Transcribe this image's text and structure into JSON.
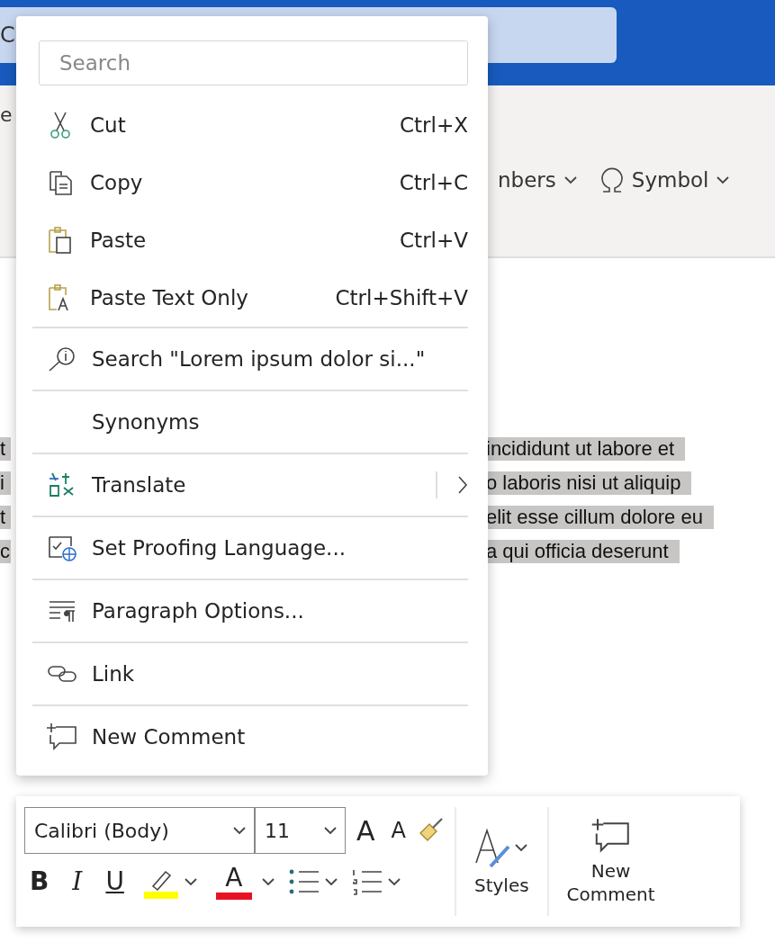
{
  "title_bar": {
    "search_fragment": "C"
  },
  "ribbon": {
    "tab_fragment": "e",
    "controls": [
      {
        "label": "nbers",
        "kind": "dropdown"
      },
      {
        "label": "Symbol",
        "kind": "symbol"
      }
    ]
  },
  "document": {
    "lines": [
      {
        "left": "t",
        "right": "incididunt ut labore et",
        "selected": true
      },
      {
        "left": "i",
        "right": "o laboris nisi ut aliquip",
        "selected": true
      },
      {
        "left": "t",
        "right": "elit esse cillum dolore eu",
        "selected": true
      },
      {
        "left": "c",
        "right": "a qui officia deserunt",
        "selected": true
      }
    ]
  },
  "context_menu": {
    "search": {
      "placeholder": "Search"
    },
    "sections": [
      [
        {
          "label": "Cut",
          "shortcut": "Ctrl+X"
        },
        {
          "label": "Copy",
          "shortcut": "Ctrl+C"
        },
        {
          "label": "Paste",
          "shortcut": "Ctrl+V"
        },
        {
          "label": "Paste Text Only",
          "shortcut": "Ctrl+Shift+V"
        }
      ],
      [
        {
          "label": "Search \"Lorem ipsum dolor si...\""
        }
      ],
      [
        {
          "label": "Synonyms"
        }
      ],
      [
        {
          "label": "Translate",
          "submenu": true
        }
      ],
      [
        {
          "label": "Set Proofing Language..."
        }
      ],
      [
        {
          "label": "Paragraph Options..."
        }
      ],
      [
        {
          "label": "Link"
        }
      ],
      [
        {
          "label": "New Comment"
        }
      ]
    ]
  },
  "mini_toolbar": {
    "font": "Calibri (Body)",
    "size": "11",
    "grow_font": "A",
    "shrink_font": "A",
    "bold": "B",
    "italic": "I",
    "underline": "U",
    "font_color": "A",
    "styles": "Styles",
    "new_comment": [
      "New",
      "Comment"
    ]
  }
}
